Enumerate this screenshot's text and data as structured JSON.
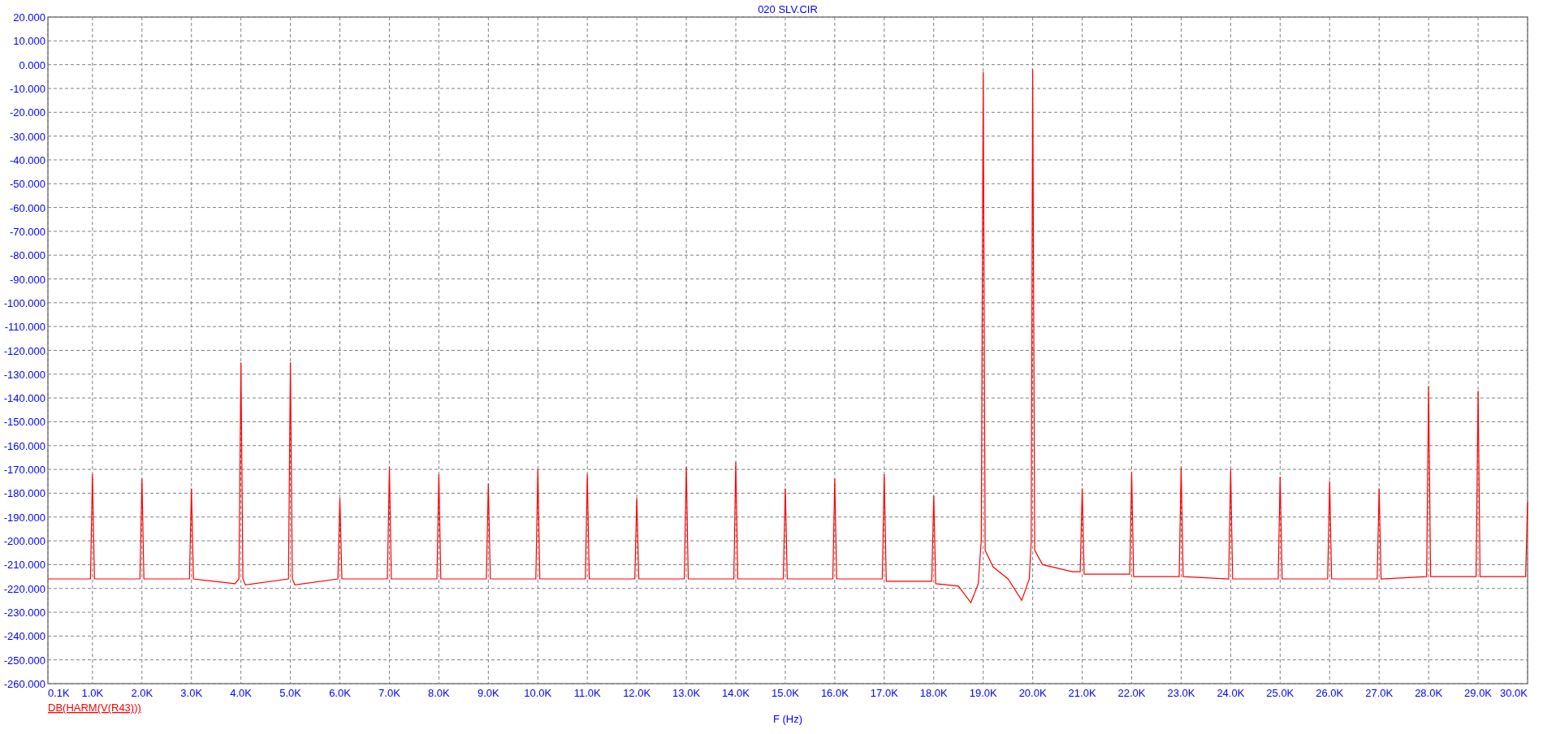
{
  "plot": {
    "chart_data": {
      "type": "line",
      "title": "020 SLV.CIR",
      "xlabel": "F (Hz)",
      "x": [
        100,
        960,
        1000,
        1040,
        1960,
        2000,
        2040,
        2960,
        3000,
        3040,
        3880,
        3960,
        4000,
        4040,
        4090,
        4960,
        5000,
        5040,
        5090,
        5960,
        6000,
        6040,
        6960,
        7000,
        7040,
        7960,
        8000,
        8040,
        8960,
        9000,
        9040,
        9960,
        10000,
        10040,
        10960,
        11000,
        11040,
        11960,
        12000,
        12040,
        12960,
        13000,
        13040,
        13960,
        14000,
        14040,
        14960,
        15000,
        15040,
        15960,
        16000,
        16040,
        16960,
        17000,
        17040,
        17960,
        18000,
        18040,
        18500,
        18750,
        18900,
        18960,
        19000,
        19040,
        19200,
        19500,
        19780,
        19930,
        19970,
        20000,
        20040,
        20200,
        20800,
        20960,
        21000,
        21040,
        21960,
        22000,
        22040,
        22960,
        23000,
        23040,
        23960,
        24000,
        24040,
        24960,
        25000,
        25040,
        25960,
        26000,
        26040,
        26960,
        27000,
        27040,
        27960,
        28000,
        28040,
        28960,
        29000,
        29040,
        29960,
        30000
      ],
      "series": [
        {
          "name": "DB(HARM(V(R43)))",
          "color": "#ff0000",
          "values": [
            -216,
            -216,
            -172,
            -216,
            -216,
            -174,
            -216,
            -216,
            -178,
            -216,
            -218,
            -216,
            -125,
            -216,
            -218.5,
            -216,
            -125,
            -216,
            -218.5,
            -216,
            -182,
            -216,
            -216,
            -169,
            -216,
            -216,
            -172,
            -216,
            -216,
            -176,
            -216,
            -216,
            -170,
            -216,
            -216,
            -172,
            -216,
            -216,
            -182,
            -216,
            -216,
            -169,
            -216,
            -216,
            -167,
            -216,
            -216,
            -178,
            -216,
            -216,
            -174,
            -216,
            -216,
            -172,
            -217,
            -217,
            -181,
            -218,
            -219,
            -226,
            -218,
            -200,
            -3,
            -204,
            -211,
            -216,
            -225,
            -216,
            -200,
            -2,
            -204,
            -210,
            -213,
            -213,
            -178,
            -214,
            -214,
            -171,
            -215,
            -215,
            -169,
            -215,
            -216,
            -170,
            -216,
            -216,
            -173,
            -216,
            -216,
            -175,
            -216,
            -216,
            -178,
            -216,
            -215,
            -135,
            -215,
            -215,
            -137,
            -215,
            -215,
            -184
          ]
        }
      ],
      "grid": true,
      "xlim": [
        100,
        30000
      ],
      "ylim": [
        -260,
        20
      ],
      "xticks": [
        {
          "value": 100,
          "label": "0.1K"
        },
        {
          "value": 1000,
          "label": "1.0K"
        },
        {
          "value": 2000,
          "label": "2.0K"
        },
        {
          "value": 3000,
          "label": "3.0K"
        },
        {
          "value": 4000,
          "label": "4.0K"
        },
        {
          "value": 5000,
          "label": "5.0K"
        },
        {
          "value": 6000,
          "label": "6.0K"
        },
        {
          "value": 7000,
          "label": "7.0K"
        },
        {
          "value": 8000,
          "label": "8.0K"
        },
        {
          "value": 9000,
          "label": "9.0K"
        },
        {
          "value": 10000,
          "label": "10.0K"
        },
        {
          "value": 11000,
          "label": "11.0K"
        },
        {
          "value": 12000,
          "label": "12.0K"
        },
        {
          "value": 13000,
          "label": "13.0K"
        },
        {
          "value": 14000,
          "label": "14.0K"
        },
        {
          "value": 15000,
          "label": "15.0K"
        },
        {
          "value": 16000,
          "label": "16.0K"
        },
        {
          "value": 17000,
          "label": "17.0K"
        },
        {
          "value": 18000,
          "label": "18.0K"
        },
        {
          "value": 19000,
          "label": "19.0K"
        },
        {
          "value": 20000,
          "label": "20.0K"
        },
        {
          "value": 21000,
          "label": "21.0K"
        },
        {
          "value": 22000,
          "label": "22.0K"
        },
        {
          "value": 23000,
          "label": "23.0K"
        },
        {
          "value": 24000,
          "label": "24.0K"
        },
        {
          "value": 25000,
          "label": "25.0K"
        },
        {
          "value": 26000,
          "label": "26.0K"
        },
        {
          "value": 27000,
          "label": "27.0K"
        },
        {
          "value": 28000,
          "label": "28.0K"
        },
        {
          "value": 29000,
          "label": "29.0K"
        },
        {
          "value": 30000,
          "label": "30.0K"
        }
      ],
      "yticks": [
        {
          "value": 20,
          "label": "20.000"
        },
        {
          "value": 10,
          "label": "10.000"
        },
        {
          "value": 0,
          "label": "0.000"
        },
        {
          "value": -10,
          "label": "-10.000"
        },
        {
          "value": -20,
          "label": "-20.000"
        },
        {
          "value": -30,
          "label": "-30.000"
        },
        {
          "value": -40,
          "label": "-40.000"
        },
        {
          "value": -50,
          "label": "-50.000"
        },
        {
          "value": -60,
          "label": "-60.000"
        },
        {
          "value": -70,
          "label": "-70.000"
        },
        {
          "value": -80,
          "label": "-80.000"
        },
        {
          "value": -90,
          "label": "-90.000"
        },
        {
          "value": -100,
          "label": "-100.000"
        },
        {
          "value": -110,
          "label": "-110.000"
        },
        {
          "value": -120,
          "label": "-120.000"
        },
        {
          "value": -130,
          "label": "-130.000"
        },
        {
          "value": -140,
          "label": "-140.000"
        },
        {
          "value": -150,
          "label": "-150.000"
        },
        {
          "value": -160,
          "label": "-160.000"
        },
        {
          "value": -170,
          "label": "-170.000"
        },
        {
          "value": -180,
          "label": "-180.000"
        },
        {
          "value": -190,
          "label": "-190.000"
        },
        {
          "value": -200,
          "label": "-200.000"
        },
        {
          "value": -210,
          "label": "-210.000"
        },
        {
          "value": -220,
          "label": "-220.000"
        },
        {
          "value": -230,
          "label": "-230.000"
        },
        {
          "value": -240,
          "label": "-240.000"
        },
        {
          "value": -250,
          "label": "-250.000"
        },
        {
          "value": -260,
          "label": "-260.000"
        }
      ]
    }
  }
}
